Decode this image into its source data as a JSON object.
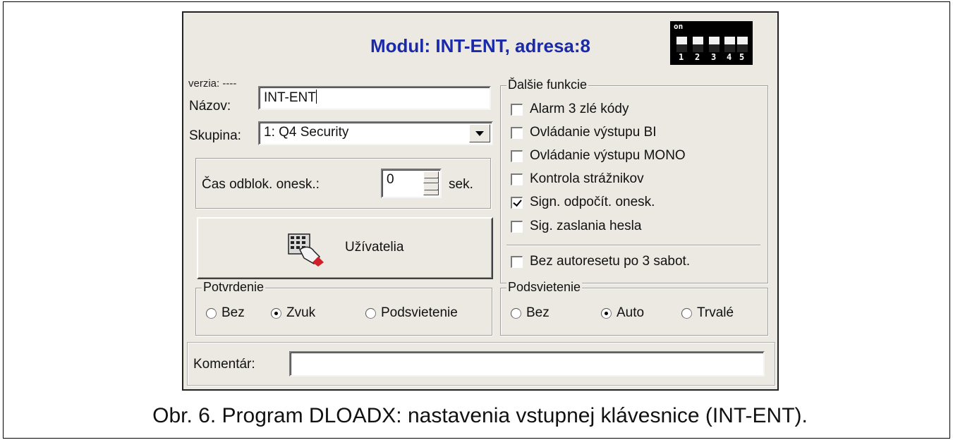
{
  "window": {
    "title": "Modul: INT-ENT, adresa:8",
    "version_label": "verzia: ----",
    "dip_switch": {
      "on_label": "on",
      "numbers": [
        "1",
        "2",
        "3",
        "4",
        "5"
      ]
    }
  },
  "fields": {
    "name_label": "Názov:",
    "name_value": "INT-ENT",
    "group_label": "Skupina:",
    "group_value": "1: Q4 Security",
    "delay_label": "Čas odblok. onesk.:",
    "delay_value": "0",
    "delay_unit": "sek.",
    "users_button": "Užívatelia",
    "comment_label": "Komentár:",
    "comment_value": ""
  },
  "functions": {
    "legend": "Ďalšie funkcie",
    "items": [
      {
        "label": "Alarm 3 zlé kódy",
        "checked": false
      },
      {
        "label": "Ovládanie výstupu BI",
        "checked": false
      },
      {
        "label": "Ovládanie výstupu MONO",
        "checked": false
      },
      {
        "label": "Kontrola strážnikov",
        "checked": false
      },
      {
        "label": "Sign. odpočít. onesk.",
        "checked": true
      },
      {
        "label": "Sig. zaslania hesla",
        "checked": false
      },
      {
        "label": "Bez autoresetu po 3 sabot.",
        "checked": false
      }
    ]
  },
  "confirmation": {
    "legend": "Potvrdenie",
    "options": [
      {
        "label": "Bez",
        "selected": false
      },
      {
        "label": "Zvuk",
        "selected": true
      },
      {
        "label": "Podsvietenie",
        "selected": false
      }
    ]
  },
  "backlight": {
    "legend": "Podsvietenie",
    "options": [
      {
        "label": "Bez",
        "selected": false
      },
      {
        "label": "Auto",
        "selected": true
      },
      {
        "label": "Trvalé",
        "selected": false
      }
    ]
  },
  "caption": "Obr. 6. Program DLOADX: nastavenia vstupnej klávesnice (INT-ENT).",
  "colors": {
    "title": "#1a2aa8",
    "dialog_bg": "#ece9e3"
  }
}
